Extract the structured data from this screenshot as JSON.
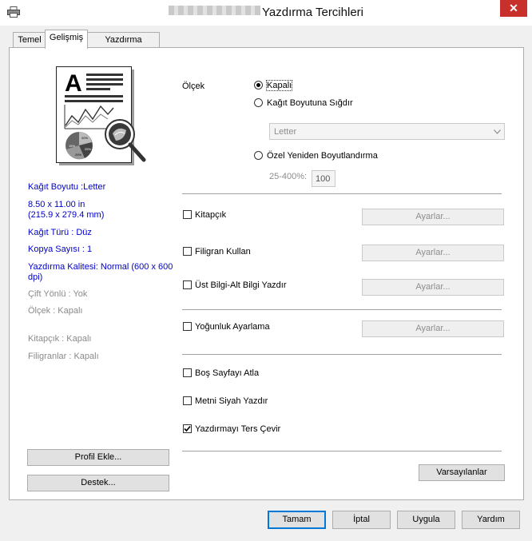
{
  "window": {
    "title": "Yazdırma Tercihleri",
    "close_glyph": "✕"
  },
  "tabs": [
    {
      "label": "Temel"
    },
    {
      "label": "Gelişmiş"
    },
    {
      "label": "Yazdırma Profilleri"
    }
  ],
  "summary": {
    "paper_size": "Kağıt Boyutu :Letter",
    "dimensions_in": "8.50 x 11.00 in",
    "dimensions_mm": "(215.9 x 279.4 mm)",
    "media_type": "Kağıt Türü : Düz",
    "copies": "Kopya Sayısı : 1",
    "quality_line1": "Yazdırma Kalitesi: Normal (600 x 600",
    "quality_line2": "dpi)",
    "duplex": "Çift Yönlü : Yok",
    "scaling": "Ölçek : Kapalı",
    "booklet": "Kitapçık : Kapalı",
    "watermark": "Filigranlar : Kapalı"
  },
  "preview_pie_labels": [
    "20%",
    "15%",
    "25%",
    "20%"
  ],
  "left_buttons": {
    "add_profile": "Profil Ekle...",
    "support": "Destek..."
  },
  "scaling": {
    "label": "Ölçek",
    "option_off": "Kapalı",
    "option_fit": "Kağıt Boyutuna Sığdır",
    "paper_select_value": "Letter",
    "option_custom": "Özel Yeniden Boyutlandırma",
    "range_label": "25-400%:",
    "custom_value": "100"
  },
  "options": {
    "booklet": "Kitapçık",
    "watermark": "Filigran Kullan",
    "header_footer": "Üst Bilgi-Alt Bilgi Yazdır",
    "density": "Yoğunluk Ayarlama",
    "skip_blank": "Boş Sayfayı Atla",
    "black_text": "Metni Siyah Yazdır",
    "reverse": "Yazdırmayı Ters Çevir"
  },
  "settings_button": "Ayarlar...",
  "defaults_button": "Varsayılanlar",
  "footer": {
    "ok": "Tamam",
    "cancel": "İptal",
    "apply": "Uygula",
    "help": "Yardım"
  },
  "icons": {
    "printer": "printer-icon",
    "close": "close-icon",
    "magnifier": "magnifier-icon"
  },
  "colors": {
    "link_text": "#0000cc",
    "close_bg": "#c7302b",
    "default_border": "#0078d7"
  },
  "state": {
    "scaling_selected": "off",
    "reverse_checked": true
  }
}
